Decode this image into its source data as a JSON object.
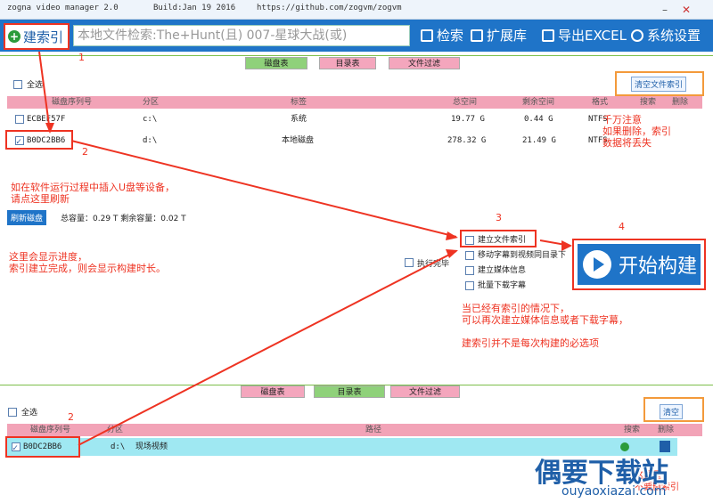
{
  "titlebar": {
    "app": "zogna video manager 2.0",
    "build": "Build:Jan 19 2016",
    "url": "https://github.com/zogvm/zogvm",
    "min": "–",
    "close": "✕"
  },
  "toolbar": {
    "build": "建索引",
    "search": "本地文件检索:The+Hunt(且) 007-星球大战(或)",
    "find": "检索",
    "ext": "扩展库",
    "export": "导出EXCEL",
    "settings": "系统设置"
  },
  "top": {
    "tabs": [
      "磁盘表",
      "目录表",
      "文件过滤"
    ],
    "select_all": "全选",
    "clear": "清空文件索引",
    "headers": [
      "磁盘序列号",
      "分区",
      "标签",
      "总空间",
      "剩余空间",
      "格式",
      "搜索",
      "删除"
    ],
    "rows": [
      {
        "serial": "ECBEF57F",
        "part": "c:\\",
        "label": "系统",
        "total": "19.77 G",
        "free": "0.44 G",
        "fmt": "NTFS"
      },
      {
        "serial": "B0DC2BB6",
        "part": "d:\\",
        "label": "本地磁盘",
        "total": "278.32 G",
        "free": "21.49 G",
        "fmt": "NTFS"
      }
    ],
    "refresh": "刷新磁盘",
    "capacity": "总容量：0.29 T  剩余容量：0.02 T",
    "exec": "执行完毕",
    "options": [
      "建立文件索引",
      "移动字幕到视频同目录下",
      "建立媒体信息",
      "批量下载字幕"
    ],
    "start": "开始构建"
  },
  "bottom": {
    "tabs": [
      "磁盘表",
      "目录表",
      "文件过滤"
    ],
    "select_all": "全选",
    "clear": "清空",
    "headers": [
      "磁盘序列号",
      "分区",
      "路径",
      "搜索",
      "删除"
    ],
    "row": {
      "serial": "B0DC2BB6",
      "part": "d:\\",
      "path": "现场视频"
    }
  },
  "annotations": {
    "n1": "1",
    "n2": "2",
    "n3": "3",
    "n4": "4",
    "n2b": "2",
    "warn": "千万注意\n如果删除，索引\n数据将丢失",
    "refresh_hint": "如在软件运行过程中插入U盘等设备，\n请点这里刷新",
    "progress_hint": "这里会显示进度，\n索引建立完成，则会显示构建时长。",
    "option_hint": "当已经有索引的情况下，\n可以再次建立媒体信息或者下载字幕，\n\n建索引并不是每次构建的必选项",
    "bottom_hint": "这里是\n不要删索引"
  },
  "watermark": {
    "brand": "偶要下载站",
    "site": "ouyaoxiazai.com"
  }
}
